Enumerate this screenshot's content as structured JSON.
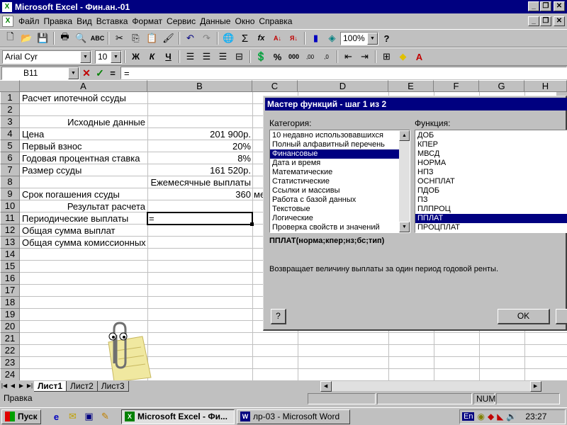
{
  "window": {
    "title": "Microsoft Excel - Фин.ан.-01"
  },
  "menu": [
    "Файл",
    "Правка",
    "Вид",
    "Вставка",
    "Формат",
    "Сервис",
    "Данные",
    "Окно",
    "Справка"
  ],
  "toolbar": {
    "zoom": "100%",
    "font": "Arial Cyr",
    "size": "10",
    "bold": "Ж",
    "italic": "К",
    "underline": "Ч"
  },
  "formula": {
    "cell_ref": "B11",
    "cancel": "✕",
    "enter": "✓",
    "equals": "=",
    "content": "="
  },
  "columns": [
    "A",
    "B",
    "C",
    "D",
    "E",
    "F",
    "G",
    "H"
  ],
  "rows": [
    "1",
    "2",
    "3",
    "4",
    "5",
    "6",
    "7",
    "8",
    "9",
    "10",
    "11",
    "12",
    "13",
    "14",
    "15",
    "16",
    "17",
    "18",
    "19",
    "20",
    "21",
    "22",
    "23",
    "24"
  ],
  "cells": {
    "a1": "Расчет ипотечной ссуды",
    "a3": "Исходные данные",
    "a4": "Цена",
    "b4": "201 900р.",
    "a5": "Первый взнос",
    "b5": "20%",
    "a6": "Годовая процентная ставка",
    "b6": "8%",
    "a7": "Размер ссуды",
    "b7": "161 520р.",
    "b8": "Ежемесячные выплаты",
    "a9": "Срок погашения ссуды",
    "b9": "360",
    "c9": "ме",
    "a10": "Результат расчета",
    "a11": "Периодические выплаты",
    "b11": "=",
    "a12": "Общая сумма выплат",
    "a13": "Общая сумма комиссионных"
  },
  "dialog": {
    "title": "Мастер функций - шаг 1 из 2",
    "category_label": "Категория:",
    "function_label": "Функция:",
    "categories": [
      "10 недавно использовавшихся",
      "Полный алфавитный перечень",
      "Финансовые",
      "Дата и время",
      "Математические",
      "Статистические",
      "Ссылки и массивы",
      "Работа с базой данных",
      "Текстовые",
      "Логические",
      "Проверка свойств и значений"
    ],
    "selected_category": "Финансовые",
    "functions": [
      "ДОБ",
      "КПЕР",
      "МВСД",
      "НОРМА",
      "НПЗ",
      "ОСНПЛАТ",
      "ПДОБ",
      "ПЗ",
      "ПЛПРОЦ",
      "ППЛАТ",
      "ПРОЦПЛАТ"
    ],
    "selected_function": "ППЛАТ",
    "syntax": "ППЛАТ(норма;кпер;нз;бс;тип)",
    "description": "Возвращает величину выплаты за один период годовой ренты.",
    "help": "?",
    "ok": "OK"
  },
  "sheets": [
    "Лист1",
    "Лист2",
    "Лист3"
  ],
  "active_sheet": "Лист1",
  "status": {
    "mode": "Правка",
    "num": "NUM"
  },
  "taskbar": {
    "start": "Пуск",
    "tasks": [
      "Microsoft Excel - Фи...",
      "лр-03 - Microsoft Word"
    ],
    "lang": "En",
    "time": "23:27"
  }
}
